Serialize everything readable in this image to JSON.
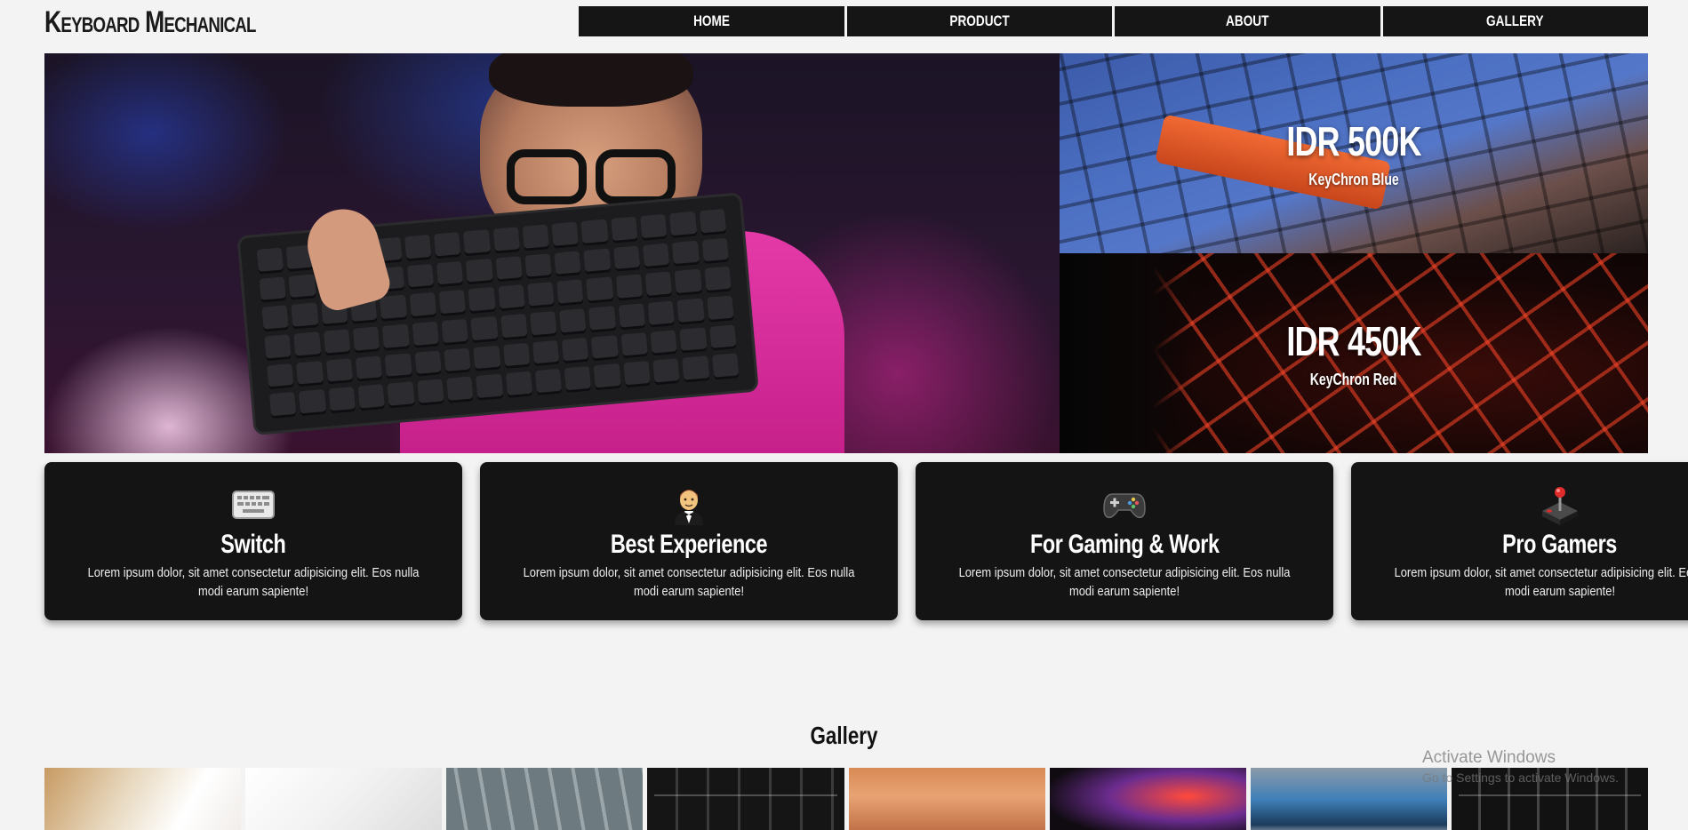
{
  "header": {
    "logo": "Keyboard Mechanical",
    "nav": [
      "HOME",
      "PRODUCT",
      "ABOUT",
      "GALLERY"
    ]
  },
  "hero": {
    "offers": [
      {
        "price": "IDR 500K",
        "model": "KeyChron Blue"
      },
      {
        "price": "IDR 450K",
        "model": "KeyChron Red"
      }
    ]
  },
  "features": [
    {
      "icon": "keyboard-icon",
      "title": "Switch",
      "text": "Lorem ipsum dolor, sit amet consectetur adipisicing elit. Eos nulla modi earum sapiente!"
    },
    {
      "icon": "man-in-tuxedo-icon",
      "title": "Best Experience",
      "text": "Lorem ipsum dolor, sit amet consectetur adipisicing elit. Eos nulla modi earum sapiente!"
    },
    {
      "icon": "game-controller-icon",
      "title": "For Gaming & Work",
      "text": "Lorem ipsum dolor, sit amet consectetur adipisicing elit. Eos nulla modi earum sapiente!"
    },
    {
      "icon": "joystick-icon",
      "title": "Pro Gamers",
      "text": "Lorem ipsum dolor, sit amet consectetur adipisicing elit. Eos nulla modi earum sapiente!"
    }
  ],
  "gallery": {
    "title": "Gallery"
  },
  "watermark": {
    "line1": "Activate Windows",
    "line2": "Go to Settings to activate Windows."
  }
}
